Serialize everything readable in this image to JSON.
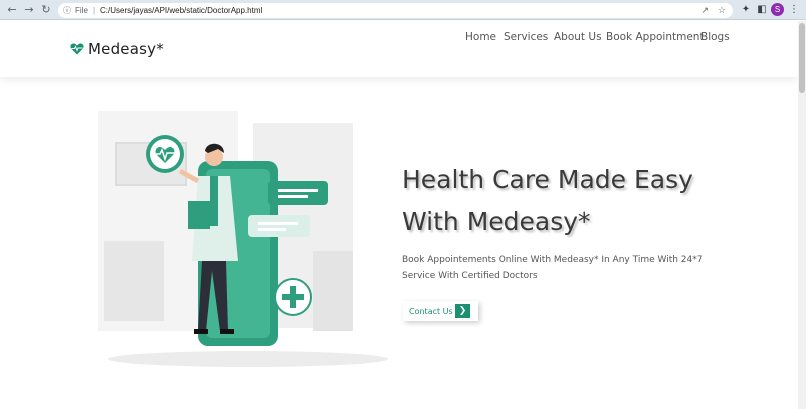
{
  "browser": {
    "file_label": "File",
    "separator": "|",
    "url": "C:/Users/jayas/API/web/static/DoctorApp.html",
    "avatar_letter": "S"
  },
  "header": {
    "brand": "Medeasy*",
    "nav": [
      "Home",
      "Services",
      "About Us",
      "Book Appointment",
      "Blogs"
    ]
  },
  "hero": {
    "title_line1": "Health Care Made Easy",
    "title_line2": "With Medeasy*",
    "subtitle_line1": "Book Appointements Online With Medeasy* In Any Time With 24*7",
    "subtitle_line2": "Service With Certified Doctors",
    "cta_label": "Contact Us",
    "cta_icon": "chevron-right-icon"
  },
  "colors": {
    "accent": "#1a8f72",
    "accent_light": "#3dbb97",
    "text_dark": "#3a3a3a"
  }
}
